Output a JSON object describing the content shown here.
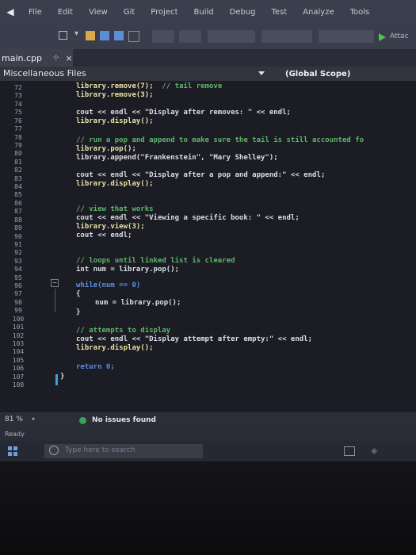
{
  "menubar": {
    "items": [
      "File",
      "Edit",
      "View",
      "Git",
      "Project",
      "Build",
      "Debug",
      "Test",
      "Analyze",
      "Tools"
    ]
  },
  "toolbar": {
    "attach_label": "Attac"
  },
  "tab": {
    "title": "main.cpp",
    "pin_glyph": "⊹",
    "close_glyph": "×"
  },
  "nav": {
    "files": "Miscellaneous Files",
    "scope": "(Global Scope)"
  },
  "gutter": {
    "lines": [
      "72",
      "73",
      "74",
      "75",
      "76",
      "77",
      "78",
      "79",
      "80",
      "81",
      "82",
      "83",
      "84",
      "85",
      "86",
      "87",
      "88",
      "89",
      "90",
      "91",
      "92",
      "93",
      "94",
      "95",
      "96",
      "97",
      "98",
      "99",
      "100",
      "101",
      "102",
      "103",
      "104",
      "105",
      "106",
      "107",
      "108"
    ]
  },
  "code": {
    "l72a": "library.remove(7);",
    "l72b": "// tail remove",
    "l73": "library.remove(3);",
    "l75": "cout << endl << \"Display after removes: \" << endl;",
    "l76": "library.display();",
    "l78": "// run a pop and append to make sure the tail is still accounted fo",
    "l79": "library.pop();",
    "l80": "library.append(\"Frankenstein\", \"Mary Shelley\");",
    "l82": "cout << endl << \"Display after a pop and append:\" << endl;",
    "l83": "library.display();",
    "l86": "// view that works",
    "l87": "cout << endl << \"Viewing a specific book: \" << endl;",
    "l88": "library.view(3);",
    "l89": "cout << endl;",
    "l92": "// loops until linked list is cleared",
    "l93": "int num = library.pop();",
    "l95": "while(num == 0)",
    "l96": "{",
    "l97": "num = library.pop();",
    "l98": "}",
    "l101": "// attempts to display",
    "l102": "cout << endl << \"Display attempt after empty:\" << endl;",
    "l103": "library.display();",
    "l106": "return 0;",
    "l107": "}"
  },
  "editstatus": {
    "zoom": "81 %",
    "zoom_arrow": "▾",
    "issues": "No issues found"
  },
  "statusbar": {
    "ready": "Ready"
  },
  "taskbar": {
    "search_placeholder": "Type here to search"
  }
}
